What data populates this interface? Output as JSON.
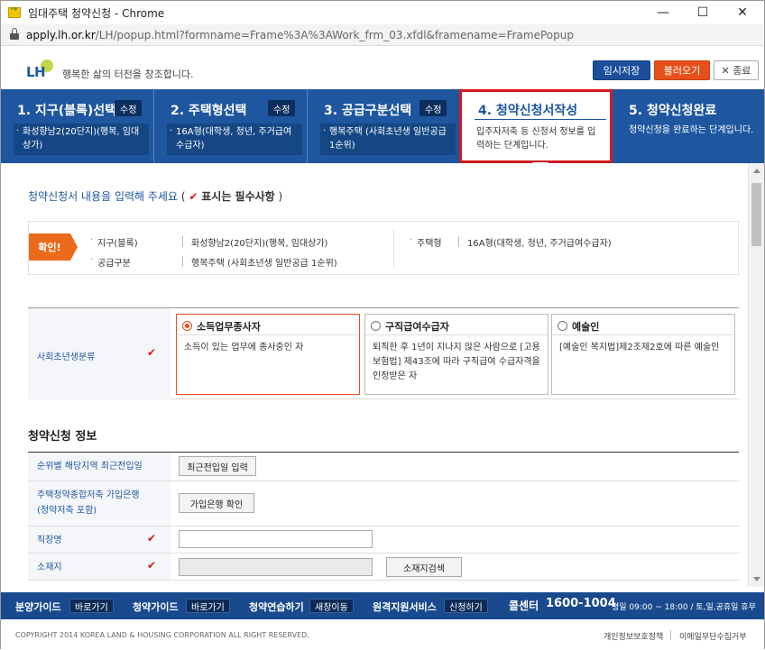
{
  "window": {
    "title": "임대주택 청약신청 - Chrome",
    "url_host": "apply.lh.or.kr",
    "url_path": "/LH/popup.html?formname=Frame%3A%3AWork_frm_03.xfdl&framename=FramePopup"
  },
  "header": {
    "logo_text": "LH",
    "slogan": "행복한 삶의 터전을 창조합니다.",
    "save_label": "임시저장",
    "load_label": "불러오기",
    "close_label": "✕ 종료"
  },
  "steps": [
    {
      "name": "1. 지구(블록)선택",
      "edit": "수정",
      "desc": "화성향남2(20단지)(행복, 임대상가)"
    },
    {
      "name": "2. 주택형선택",
      "edit": "수정",
      "desc": "16A형(대학생, 청년, 주거급여수급자)"
    },
    {
      "name": "3. 공급구분선택",
      "edit": "수정",
      "desc": "행복주택 (사회초년생 일반공급 1순위)"
    },
    {
      "name": "4. 청약신청서작성",
      "desc": "입주자저축 등 신청서 정보를 입력하는 단계입니다."
    },
    {
      "name": "5. 청약신청완료",
      "desc": "청약신청을 완료하는 단계입니다."
    }
  ],
  "form": {
    "intro": "청약신청서 내용을 입력해 주세요",
    "intro_open": "(",
    "intro_check": "✔",
    "intro_req": "표시는 필수사항",
    "intro_close": ")",
    "confirm_tag": "확인!",
    "confirm": {
      "district_label": "지구(블록)",
      "district_value": "화성향남2(20단지)(행복, 임대상가)",
      "type_label": "주택형",
      "type_value": "16A형(대학생, 청년, 주거급여수급자)",
      "supply_label": "공급구분",
      "supply_value": "행복주택 (사회초년생 일반공급 1순위)"
    },
    "classification_label": "사회초년생분류",
    "options": [
      {
        "title": "소득업무종사자",
        "desc": "소득이 있는 업무에 종사중인 자",
        "selected": true
      },
      {
        "title": "구직급여수급자",
        "desc": "퇴직한 후 1년이 지나지 않은 사람으로 [고용보험법] 제43조에 따라 구직급여 수급자격을 인정받은 자",
        "selected": false
      },
      {
        "title": "예술인",
        "desc": "[예술인 복지법]제2조제2호에 따른 예술인",
        "selected": false
      }
    ],
    "section_title": "청약신청 정보",
    "rows": {
      "recent_label": "순위별 해당지역 최근전입일",
      "recent_btn": "최근전입일 입력",
      "bank_label_1": "주택청약종합저축 가입은행",
      "bank_label_2": "(청약저축 포함)",
      "bank_btn": "가입은행 확인",
      "workplace_label": "직장명",
      "workplace_value": "",
      "address_label": "소재지",
      "address_value": "",
      "address_btn": "소재지검색"
    }
  },
  "footer": {
    "items": [
      {
        "label": "분양가이드",
        "btn": "바로가기"
      },
      {
        "label": "청약가이드",
        "btn": "바로가기"
      },
      {
        "label": "청약연습하기",
        "btn": "새창이동"
      },
      {
        "label": "원격지원서비스",
        "btn": "신청하기"
      }
    ],
    "call_label": "콜센터",
    "call_number": "1600-1004",
    "hours": "평일 09:00 ~ 18:00 / 토,일,공휴일 휴무",
    "copyright": "COPYRIGHT 2014 KOREA LAND & HOUSING CORPORATION ALL RIGHT RESERVED.",
    "privacy": "개인정보보호정책",
    "email": "이메일무단수집거부"
  },
  "colors": {
    "brand_blue": "#1e56a0",
    "accent_orange": "#e8501a",
    "active_border": "#d3191f"
  }
}
